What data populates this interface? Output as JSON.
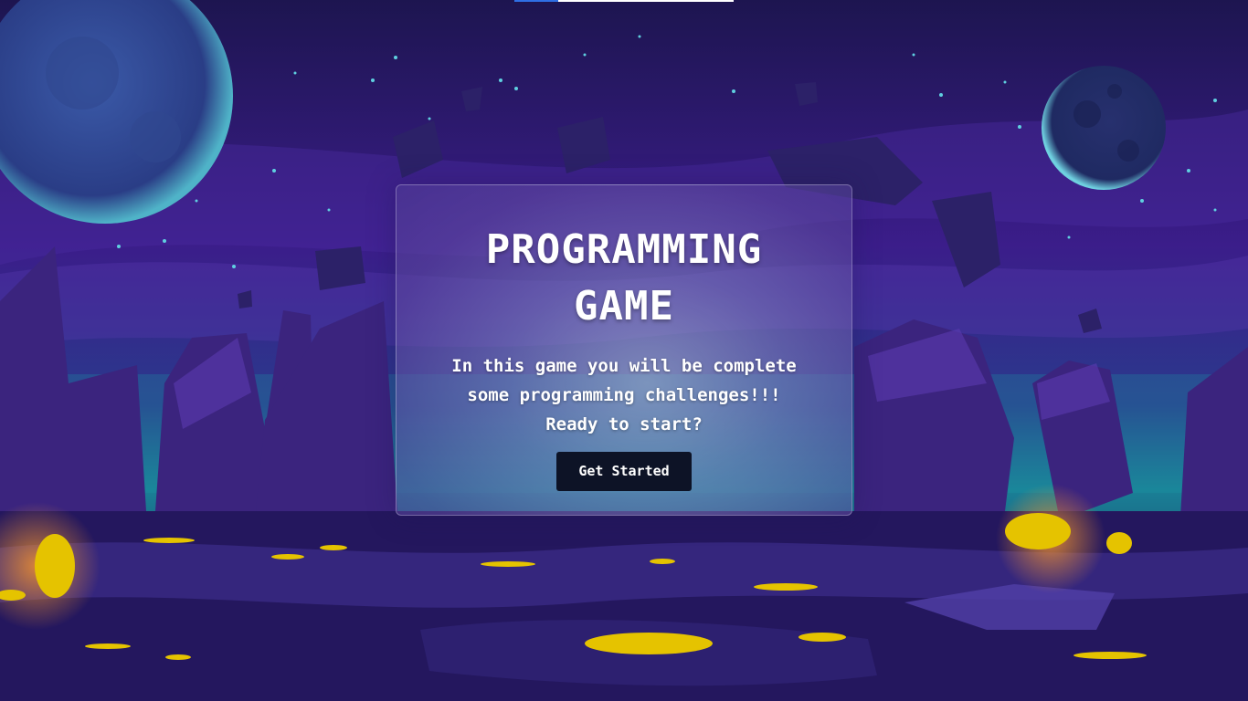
{
  "loading_bar": {
    "progress_percent": 20,
    "fill_color": "#2f6fe4",
    "track_color": "#ffffff"
  },
  "card": {
    "title_line1": "PROGRAMMING",
    "title_line2": "GAME",
    "description_line1": "In this game you will be complete",
    "description_line2": "some programming challenges!!!",
    "description_line3": "Ready to start?",
    "button_label": "Get Started"
  },
  "colors": {
    "sky_top": "#1d1550",
    "sky_mid": "#3b1d8a",
    "horizon_glow": "#1a8a9a",
    "lava": "#e5c300",
    "button_bg": "#0d1326"
  }
}
